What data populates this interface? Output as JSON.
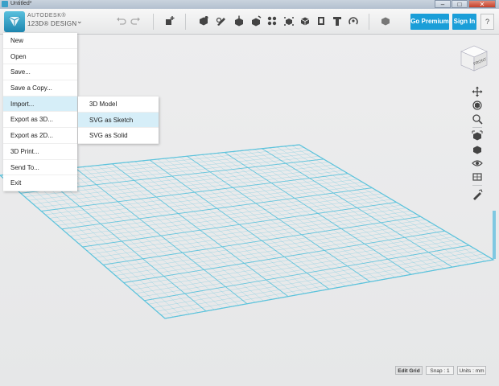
{
  "window": {
    "title": "Untitled*"
  },
  "brand": {
    "line1": "AUTODESK®",
    "line2": "123D® DESIGN"
  },
  "toolbar": {
    "premium_label": "Go Premium",
    "signin_label": "Sign In",
    "help_label": "?",
    "tools": [
      "undo-icon",
      "redo-icon",
      "transform-icon",
      "primitives-icon",
      "sketch-icon",
      "construct-icon",
      "modify-icon",
      "pattern-icon",
      "grouping-icon",
      "combine-icon",
      "measure-icon",
      "text-icon",
      "snap-icon",
      "material-icon"
    ]
  },
  "menu": {
    "items": [
      {
        "label": "New",
        "name": "menu-item-new"
      },
      {
        "label": "Open",
        "name": "menu-item-open"
      },
      {
        "label": "Save...",
        "name": "menu-item-save"
      },
      {
        "label": "Save a Copy...",
        "name": "menu-item-save-copy"
      },
      {
        "label": "Import...",
        "name": "menu-item-import",
        "active": true
      },
      {
        "label": "Export as 3D...",
        "name": "menu-item-export-3d"
      },
      {
        "label": "Export as 2D...",
        "name": "menu-item-export-2d"
      },
      {
        "label": "3D Print...",
        "name": "menu-item-3d-print"
      },
      {
        "label": "Send To...",
        "name": "menu-item-send-to"
      },
      {
        "label": "Exit",
        "name": "menu-item-exit"
      }
    ]
  },
  "submenu": {
    "items": [
      {
        "label": "3D Model",
        "name": "submenu-item-3d-model"
      },
      {
        "label": "SVG as Sketch",
        "name": "submenu-item-svg-sketch",
        "active": true
      },
      {
        "label": "SVG as Solid",
        "name": "submenu-item-svg-solid"
      }
    ]
  },
  "viewcube": {
    "face_label": "FRONT"
  },
  "status": {
    "edit_grid": "Edit Grid",
    "snap": "Snap : 1",
    "units": "Units : mm"
  },
  "colors": {
    "accent": "#1a9ed8",
    "grid": "#5cc3dc",
    "menu_highlight": "#d6eef8"
  }
}
